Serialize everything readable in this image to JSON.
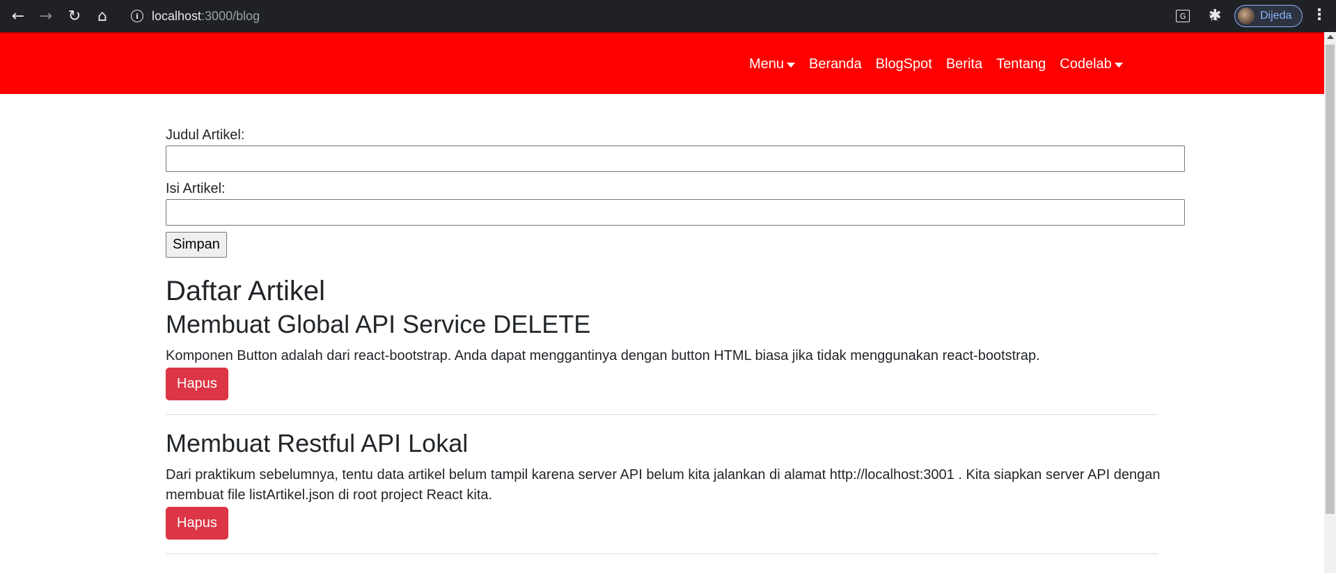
{
  "browser": {
    "url_host": "localhost",
    "url_path": ":3000/blog",
    "profile_name": "Dijeda"
  },
  "navbar": {
    "items": [
      {
        "label": "Menu",
        "dropdown": true
      },
      {
        "label": "Beranda",
        "dropdown": false
      },
      {
        "label": "BlogSpot",
        "dropdown": false
      },
      {
        "label": "Berita",
        "dropdown": false
      },
      {
        "label": "Tentang",
        "dropdown": false
      },
      {
        "label": "Codelab",
        "dropdown": true
      }
    ],
    "background_color": "#ff0000"
  },
  "form": {
    "title_label": "Judul Artikel:",
    "title_value": "",
    "body_label": "Isi Artikel:",
    "body_value": "",
    "save_label": "Simpan"
  },
  "list": {
    "heading": "Daftar Artikel",
    "articles": [
      {
        "title": "Membuat Global API Service DELETE",
        "body": "Komponen Button adalah dari react-bootstrap. Anda dapat menggantinya dengan button HTML biasa jika tidak menggunakan react-bootstrap.",
        "delete_label": "Hapus"
      },
      {
        "title": "Membuat Restful API Lokal",
        "body": "Dari praktikum sebelumnya, tentu data artikel belum tampil karena server API belum kita jalankan di alamat http://localhost:3001 . Kita siapkan server API dengan membuat file listArtikel.json di root project React kita.",
        "delete_label": "Hapus"
      }
    ],
    "delete_color": "#dc3545"
  }
}
